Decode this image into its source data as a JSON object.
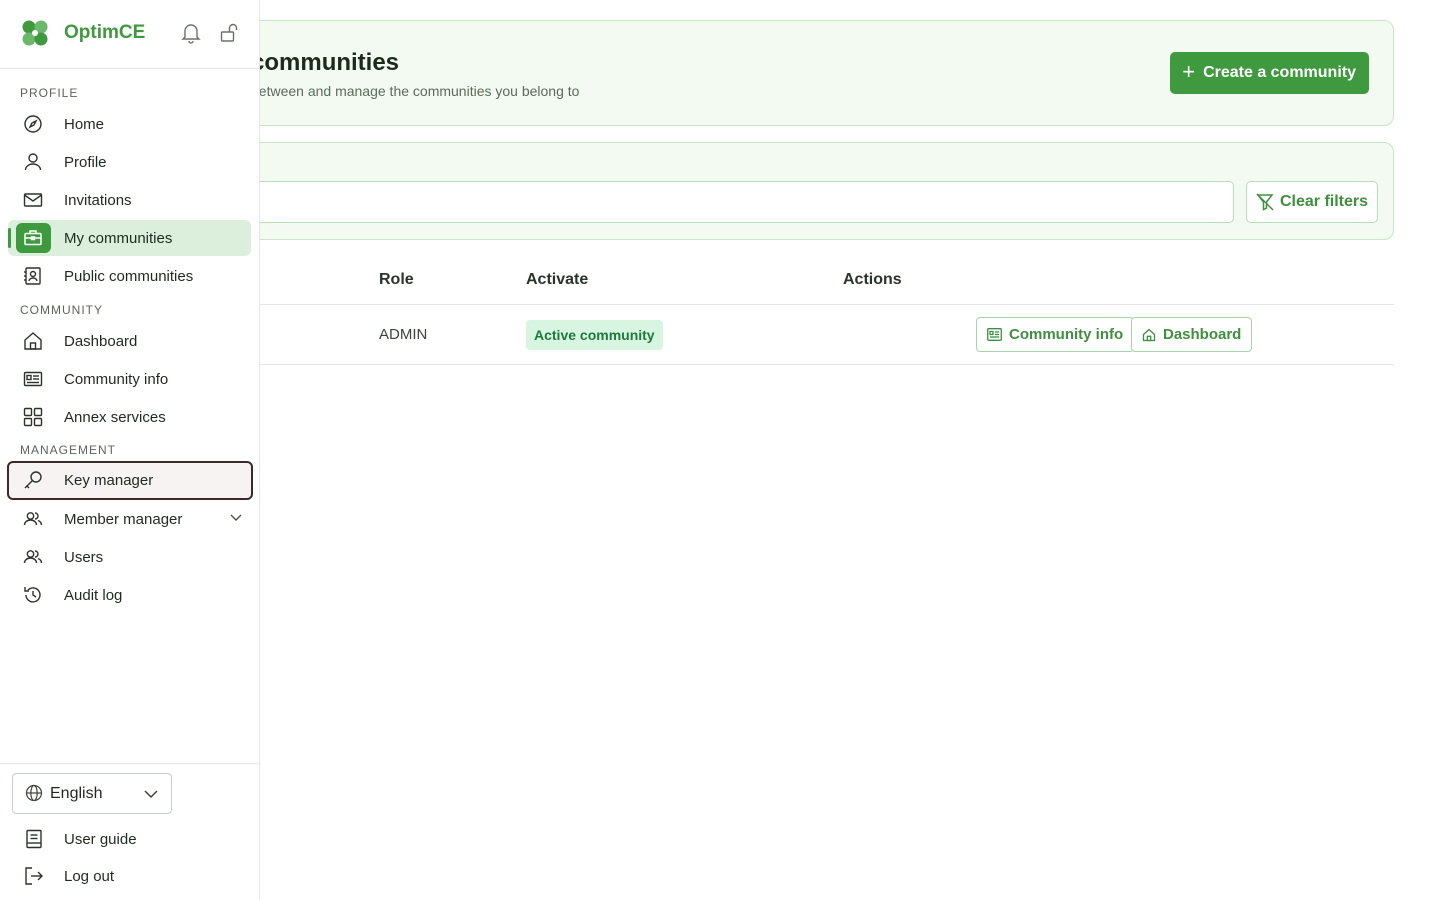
{
  "app": {
    "brand_name": "OptimCE"
  },
  "header": {
    "title": "My communities",
    "title_visible": "communities",
    "subtitle_visible": "between and manage the communities you belong to",
    "create_button_label": "Create a community"
  },
  "filters": {
    "search_placeholder": "",
    "clear_button_label": "Clear filters"
  },
  "table": {
    "columns": [
      "Role",
      "Activate",
      "Actions"
    ],
    "rows": [
      {
        "role": "ADMIN",
        "status": "Active community",
        "actions": [
          "Community info",
          "Dashboard"
        ]
      }
    ]
  },
  "sidebar": {
    "sections": [
      {
        "label": "PROFILE"
      },
      {
        "label": "COMMUNITY"
      },
      {
        "label": "MANAGEMENT"
      }
    ],
    "profile_items": [
      {
        "label": "Home",
        "icon": "compass-icon"
      },
      {
        "label": "Profile",
        "icon": "user-icon"
      },
      {
        "label": "Invitations",
        "icon": "envelope-icon"
      },
      {
        "label": "My communities",
        "icon": "briefcase-icon",
        "active": true
      },
      {
        "label": "Public communities",
        "icon": "contact-book-icon"
      }
    ],
    "community_items": [
      {
        "label": "Dashboard",
        "icon": "home-icon"
      },
      {
        "label": "Community info",
        "icon": "id-card-icon"
      },
      {
        "label": "Annex services",
        "icon": "grid-icon"
      }
    ],
    "management_items": [
      {
        "label": "Key manager",
        "icon": "key-icon",
        "focused": true
      },
      {
        "label": "Member manager",
        "icon": "users-icon",
        "expandable": true
      },
      {
        "label": "Users",
        "icon": "users-icon"
      },
      {
        "label": "Audit log",
        "icon": "history-icon"
      }
    ],
    "language": {
      "selected": "English"
    },
    "footer_items": [
      {
        "label": "User guide",
        "icon": "book-icon"
      },
      {
        "label": "Log out",
        "icon": "logout-icon"
      }
    ]
  },
  "colors": {
    "brand_green": "#3f9a3f",
    "card_bg": "#f2faf2",
    "active_nav_bg": "#dcefdc",
    "badge_bg": "#d8f5e2",
    "badge_text": "#1e7a3a"
  }
}
